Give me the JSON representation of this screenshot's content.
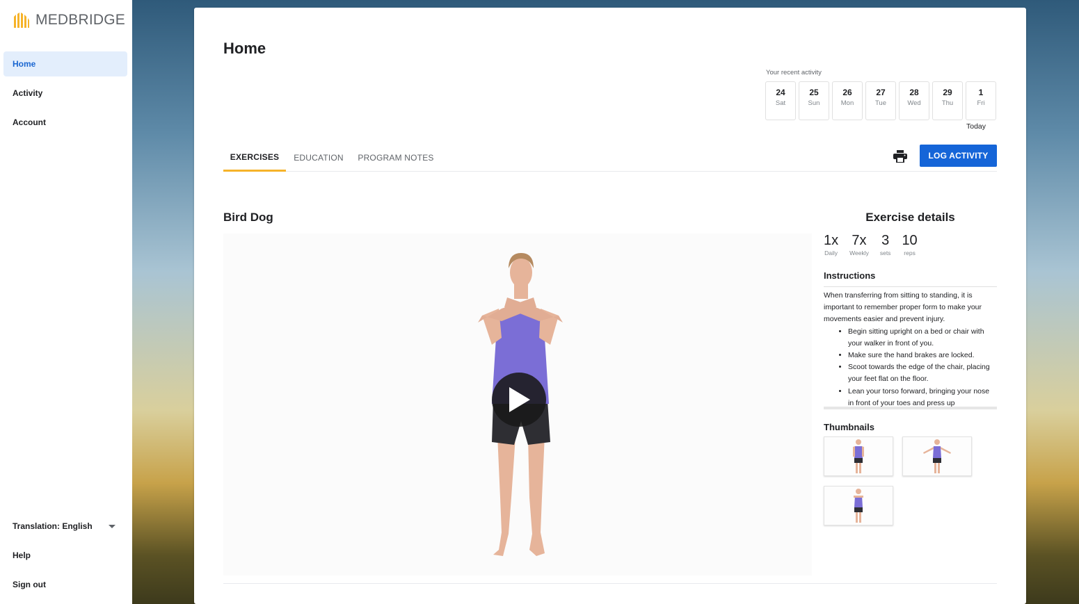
{
  "brand": {
    "name": "MEDBRIDGE",
    "logo_color": "#f6b329"
  },
  "sidebar": {
    "items": [
      {
        "label": "Home",
        "active": true
      },
      {
        "label": "Activity",
        "active": false
      },
      {
        "label": "Account",
        "active": false
      }
    ],
    "translation": "Translation: English",
    "help": "Help",
    "sign_out": "Sign out"
  },
  "main": {
    "title": "Home",
    "recent_activity_label": "Your recent activity",
    "days": [
      {
        "num": "24",
        "name": "Sat"
      },
      {
        "num": "25",
        "name": "Sun"
      },
      {
        "num": "26",
        "name": "Mon"
      },
      {
        "num": "27",
        "name": "Tue"
      },
      {
        "num": "28",
        "name": "Wed"
      },
      {
        "num": "29",
        "name": "Thu"
      },
      {
        "num": "1",
        "name": "Fri"
      }
    ],
    "today_label": "Today",
    "tabs": [
      {
        "label": "EXERCISES",
        "active": true
      },
      {
        "label": "EDUCATION",
        "active": false
      },
      {
        "label": "PROGRAM NOTES",
        "active": false
      }
    ],
    "print_icon": "printer-icon",
    "log_activity_label": "LOG ACTIVITY",
    "accent_color": "#1565d8"
  },
  "exercise": {
    "title": "Bird Dog",
    "details_title": "Exercise details",
    "stats": [
      {
        "value": "1x",
        "label": "Daily"
      },
      {
        "value": "7x",
        "label": "Weekly"
      },
      {
        "value": "3",
        "label": "sets"
      },
      {
        "value": "10",
        "label": "reps"
      }
    ],
    "instructions_title": "Instructions",
    "instructions_intro": "When transferring from sitting to standing, it is important to remember proper form to make your movements easier and prevent injury.",
    "instructions_steps": [
      "Begin sitting upright on a bed or chair with your walker in front of you.",
      "Make sure the hand brakes are locked.",
      "Scoot towards the edge of the chair, placing your feet flat on the floor.",
      "Lean your torso forward, bringing your nose in front of your toes and press up"
    ],
    "thumbnails_title": "Thumbnails"
  }
}
